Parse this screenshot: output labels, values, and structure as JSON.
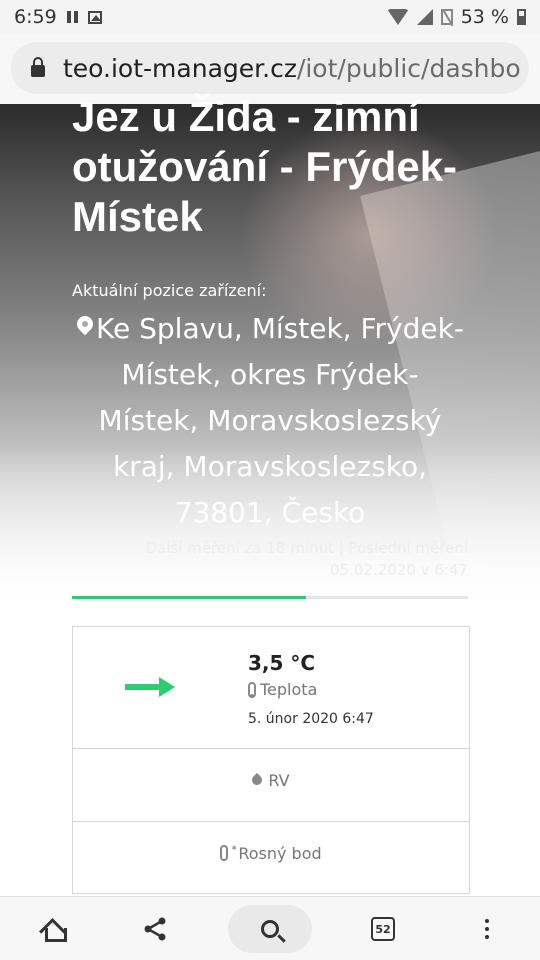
{
  "status_bar": {
    "time": "6:59",
    "battery_percent": "53 %"
  },
  "browser": {
    "url_domain": "teo.iot-manager.cz",
    "url_path": "/iot/public/dashbo",
    "tab_count": "52"
  },
  "page": {
    "title": "Jez u Žida - zimní otužování - Frýdek-Místek",
    "position_label": "Aktuální pozice zařízení:",
    "address": "Ke Splavu, Místek, Frýdek-Místek, okres Frýdek-Místek, Moravskoslezský kraj, Moravskoslezsko, 73801, Česko",
    "next_measurement": "Další měření za 18 minut | Poslední měření 05.02.2020 v 6:47",
    "progress_fraction": 0.59
  },
  "measurements": {
    "temperature": {
      "value": "3,5 °C",
      "label": "Teplota",
      "date": "5. únor 2020 6:47",
      "trend": "steady",
      "trend_color": "#2ecc71"
    },
    "humidity": {
      "label": "RV"
    },
    "dew_point": {
      "label": "Rosný bod"
    }
  },
  "icons": {
    "status": [
      "pause-icon",
      "photo-icon",
      "wifi-icon",
      "signal-icon",
      "no-sim-icon",
      "battery-icon"
    ],
    "nav": [
      "home-icon",
      "share-icon",
      "search-icon",
      "tab-switcher-icon",
      "overflow-menu-icon"
    ]
  },
  "colors": {
    "accent": "#2ecc71"
  }
}
